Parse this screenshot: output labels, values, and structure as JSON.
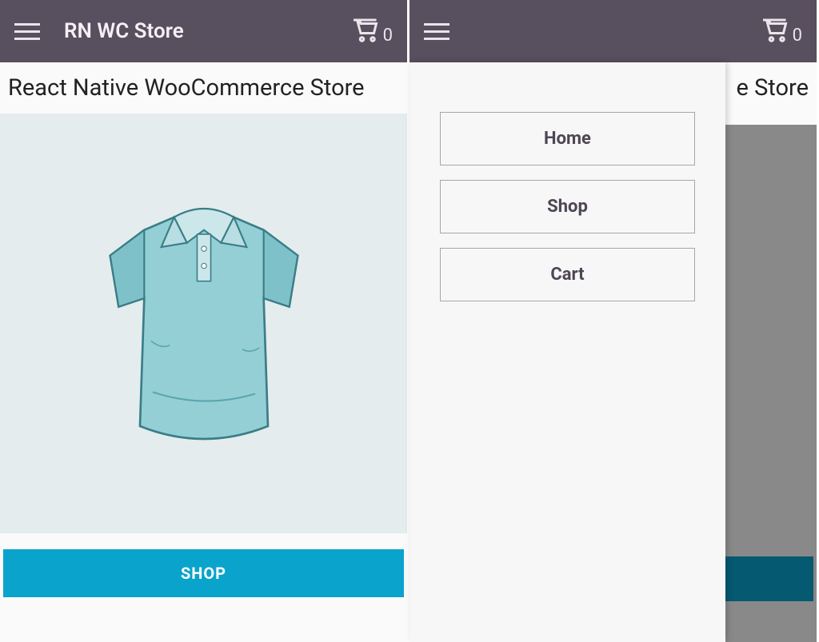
{
  "header": {
    "title": "RN WC Store",
    "cart_count": "0"
  },
  "page": {
    "title": "React Native WooCommerce Store",
    "shop_button": "SHOP"
  },
  "drawer": {
    "items": [
      {
        "label": "Home"
      },
      {
        "label": "Shop"
      },
      {
        "label": "Cart"
      }
    ]
  },
  "screen2": {
    "title_peek": "e Store"
  }
}
